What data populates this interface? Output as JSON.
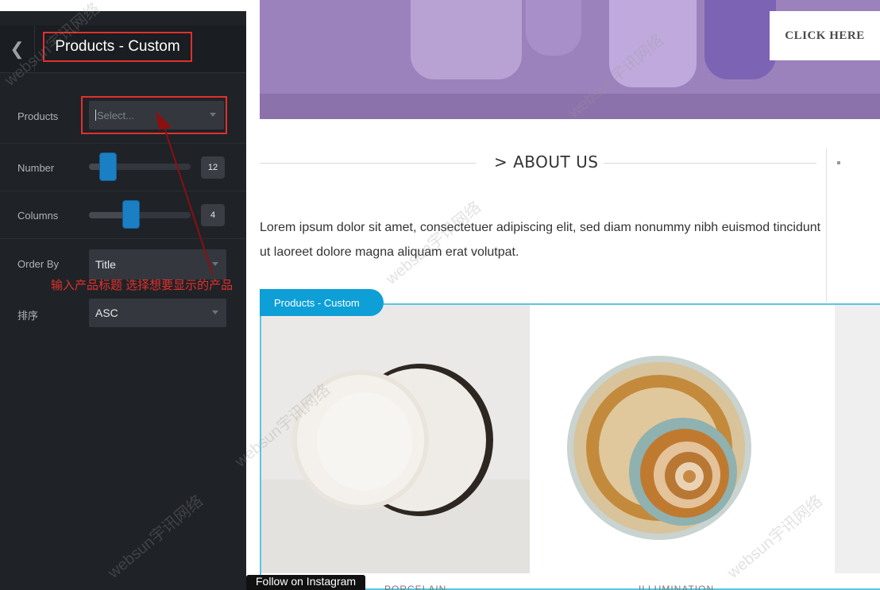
{
  "sidebar": {
    "back_icon": "chevron-left-icon",
    "title": "Products - Custom",
    "fields": {
      "products": {
        "label": "Products",
        "placeholder": "Select..."
      },
      "number": {
        "label": "Number",
        "value": "12",
        "level": 0.12
      },
      "columns": {
        "label": "Columns",
        "value": "4",
        "level": 0.4
      },
      "order_by": {
        "label": "Order By",
        "value": "Title"
      },
      "sort": {
        "label": "排序",
        "value": "ASC"
      }
    },
    "annotation": "输入产品标题 选择想要显示的产品"
  },
  "main": {
    "cta": "CLICK HERE",
    "about": {
      "title": "ABOUT US",
      "chevron": ">",
      "body": "Lorem ipsum dolor sit amet, consectetuer adipiscing elit, sed diam nonummy nibh euismod tincidunt ut laoreet dolore magna aliquam erat volutpat."
    },
    "products_tag": "Products - Custom",
    "products": [
      {
        "caption": "PORCELAIN"
      },
      {
        "caption": "ILLUMINATION"
      }
    ],
    "follow": "Follow on Instagram"
  },
  "watermark": "websun宇讯网络",
  "colors": {
    "sidebar_bg": "#1f2227",
    "highlight_red": "#e0312c",
    "slider_blue": "#1b7fc4",
    "tag_blue": "#0e9fd7",
    "banner_purple": "#9c82bc"
  }
}
